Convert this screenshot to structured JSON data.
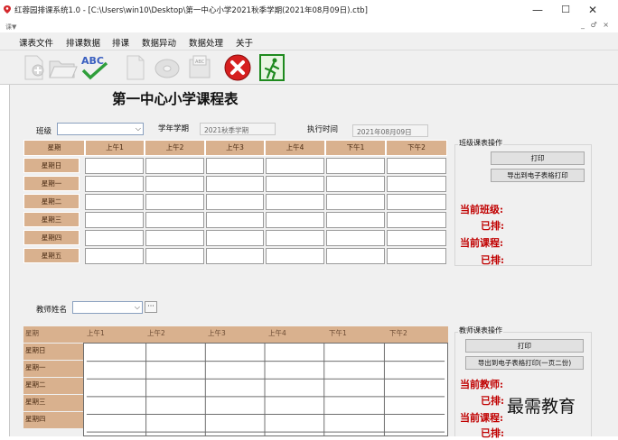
{
  "window": {
    "title": "红蓉园排课系统1.0 - [C:\\Users\\win10\\Desktop\\第一中心小学2021秋季学期(2021年08月09日).ctb]",
    "minimize_glyph": "—",
    "maximize_glyph": "☐",
    "close_glyph": "✕",
    "mdi_icon_text": "课▼",
    "mdi_controls": "_ ♂ ×"
  },
  "menu": [
    "课表文件",
    "排课数据",
    "排课",
    "数据异动",
    "数据处理",
    "关于"
  ],
  "toolbar": {
    "icons": [
      "new-doc-icon",
      "open-folder-icon",
      "spellcheck-abc-icon",
      "blank-page-icon",
      "disc-icon",
      "abc-tray-icon",
      "close-red-icon",
      "exit-door-icon"
    ],
    "abc_text": "ABC",
    "abc_small_text": "ABC"
  },
  "heading": "第一中心小学课程表",
  "filters": {
    "class_label": "班级",
    "class_value": "",
    "term_label": "学年学期",
    "term_value": "2021秋季学期",
    "exec_label": "执行时间",
    "exec_value": "2021年08月09日"
  },
  "class_table": {
    "headers": [
      "星期",
      "上午1",
      "上午2",
      "上午3",
      "上午4",
      "下午1",
      "下午2"
    ],
    "days": [
      "星期日",
      "星期一",
      "星期二",
      "星期三",
      "星期四",
      "星期五"
    ]
  },
  "class_ops": {
    "group_title": "班级课表操作",
    "print_label": "打印",
    "export_label": "导出到电子表格打印",
    "current_class_label": "当前班级:",
    "scheduled_label": "已排:",
    "current_course_label": "当前课程:",
    "scheduled2_label": "已排:"
  },
  "teacher": {
    "label": "教师姓名",
    "value": "",
    "dots_label": "···"
  },
  "teacher_table": {
    "headers": [
      "星期",
      "上午1",
      "上午2",
      "上午3",
      "上午4",
      "下午1",
      "下午2"
    ],
    "days": [
      "星期日",
      "星期一",
      "星期二",
      "星期三",
      "星期四"
    ]
  },
  "teacher_ops": {
    "group_title": "教师课表操作",
    "print_label": "打印",
    "export_label": "导出到电子表格打印(一页二份)",
    "current_teacher_label": "当前教师:",
    "scheduled_label": "已排:",
    "current_course_label": "当前课程:",
    "scheduled2_label": "已排:"
  },
  "watermark": "最需教育",
  "colors": {
    "header_tan": "#d9b18e",
    "red_text": "#c00000",
    "panel_gray": "#f0f0f0"
  }
}
